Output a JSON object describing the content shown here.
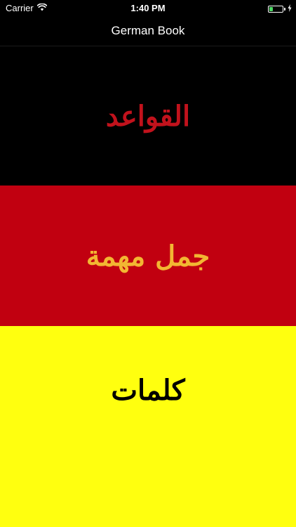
{
  "status_bar": {
    "carrier": "Carrier",
    "time": "1:40 PM",
    "battery_level": 0.3,
    "wifi_icon": "wifi-icon",
    "battery_icon": "battery-icon",
    "charging_icon": "charging-bolt-icon"
  },
  "nav": {
    "title": "German Book"
  },
  "sections": [
    {
      "label": "القواعد",
      "background": "#000000",
      "text_color": "#c1121c"
    },
    {
      "label": "جمل مهمة",
      "background": "#c10010",
      "text_color": "#f2b632"
    },
    {
      "label": "كلمات",
      "background": "#ffff0f",
      "text_color": "#000000"
    }
  ],
  "colors": {
    "battery_fill": "#4cd964",
    "status_text": "#ffffff"
  }
}
